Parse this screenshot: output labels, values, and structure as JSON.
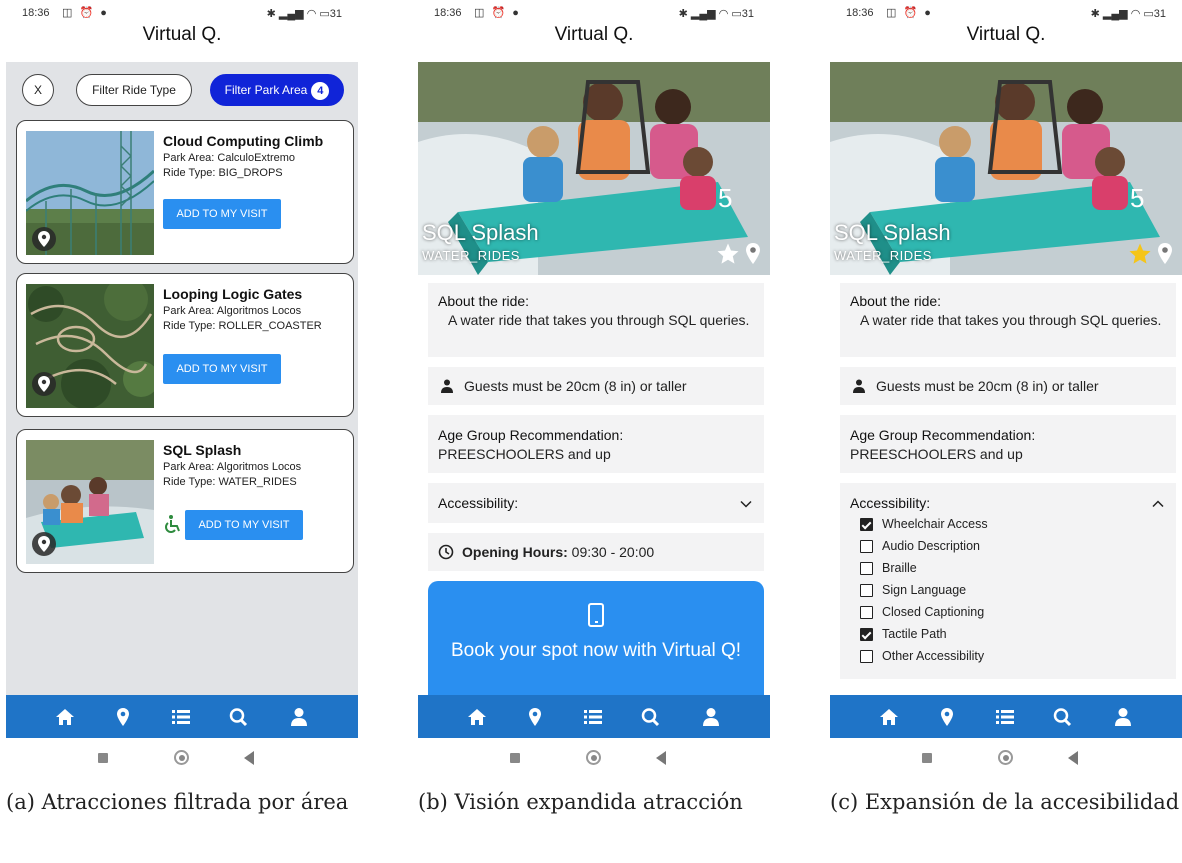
{
  "status": {
    "time": "18:36",
    "battery": "31"
  },
  "app_title": "Virtual Q.",
  "filters": {
    "clear": "X",
    "ride_type": "Filter Ride Type",
    "park_area": "Filter Park Area",
    "park_area_count": "4"
  },
  "rides": [
    {
      "name": "Cloud Computing Climb",
      "park_area": "Park Area: CalculoExtremo",
      "ride_type": "Ride Type: BIG_DROPS",
      "button": "ADD TO MY VISIT",
      "accessible": false
    },
    {
      "name": "Looping Logic Gates",
      "park_area": "Park Area: Algoritmos Locos",
      "ride_type": "Ride Type: ROLLER_COASTER",
      "button": "ADD TO MY VISIT",
      "accessible": false
    },
    {
      "name": "SQL Splash",
      "park_area": "Park Area: Algoritmos Locos",
      "ride_type": "Ride Type: WATER_RIDES",
      "button": "ADD TO MY VISIT",
      "accessible": true
    }
  ],
  "detail": {
    "title": "SQL Splash",
    "subtitle": "WATER_RIDES",
    "about_label": "About the ride:",
    "about_text": "A water ride that takes you through SQL queries.",
    "height_text": "Guests must be 20cm (8 in) or taller",
    "age_label": "Age Group Recommendation:",
    "age_text": "PREESCHOOLERS and up",
    "accessibility_label": "Accessibility:",
    "hours_label": "Opening Hours:",
    "hours_value": "09:30 - 20:00",
    "book_text": "Book your spot now with Virtual Q!"
  },
  "accessibility_options": [
    {
      "label": "Wheelchair Access",
      "checked": true
    },
    {
      "label": "Audio Description",
      "checked": false
    },
    {
      "label": "Braille",
      "checked": false
    },
    {
      "label": "Sign Language",
      "checked": false
    },
    {
      "label": "Closed Captioning",
      "checked": false
    },
    {
      "label": "Tactile Path",
      "checked": true
    },
    {
      "label": "Other Accessibility",
      "checked": false
    }
  ],
  "nav": [
    "home-icon",
    "map-pin-icon",
    "list-icon",
    "search-icon",
    "user-icon"
  ],
  "colors": {
    "nav_bar": "#1f74c7",
    "button": "#2a8ff0",
    "chip_active": "#1024d8",
    "star_favorite": "#f5c518"
  },
  "captions": {
    "a": "(a) Atracciones filtrada por área",
    "b": "(b) Visión expandida atracción",
    "c": "(c) Expansión de la accesibilidad"
  }
}
